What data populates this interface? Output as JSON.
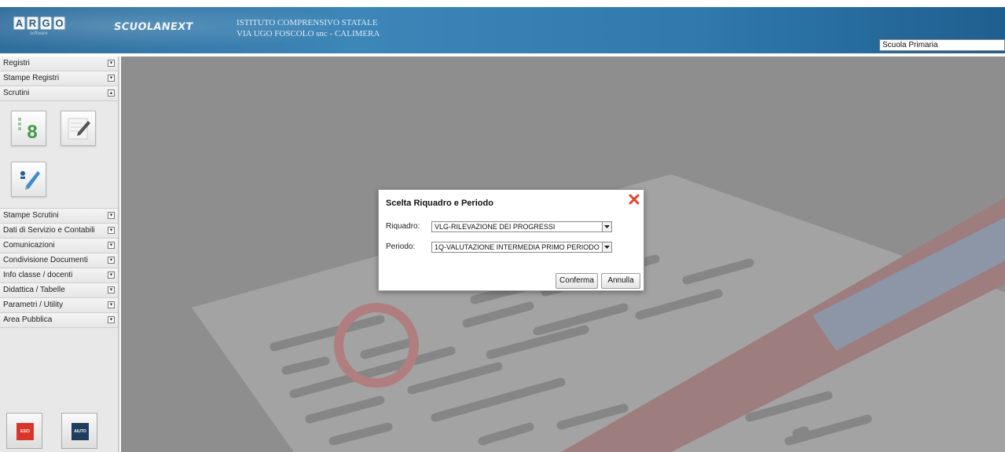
{
  "header": {
    "logo_letters": [
      "A",
      "R",
      "G",
      "O"
    ],
    "logo_sub": "software",
    "brand": "SCUOLANEXT",
    "school_line1": "ISTITUTO COMPRENSIVO STATALE",
    "school_line2": "VIA UGO FOSCOLO snc - CALIMERA",
    "school_type": "Scuola Primaria"
  },
  "sidebar": {
    "items_top": [
      {
        "label": "Registri",
        "toggle": "▾"
      },
      {
        "label": "Stampe Registri",
        "toggle": "▾"
      },
      {
        "label": "Scrutini",
        "toggle": "▴"
      }
    ],
    "items_bottom": [
      {
        "label": "Stampe Scrutini",
        "toggle": "▾"
      },
      {
        "label": "Dati di Servizio e Contabili",
        "toggle": "▾"
      },
      {
        "label": "Comunicazioni",
        "toggle": "▾"
      },
      {
        "label": "Condivisione Documenti",
        "toggle": "▾"
      },
      {
        "label": "Info classe / docenti",
        "toggle": "▾"
      },
      {
        "label": "Didattica / Tabelle",
        "toggle": "▾"
      },
      {
        "label": "Parametri / Utility",
        "toggle": "▾"
      },
      {
        "label": "Area Pubblica",
        "toggle": "▾"
      }
    ],
    "tools": {
      "voti_number": "8"
    },
    "exit_label": "ESCI",
    "help_label": "AIUTO"
  },
  "dialog": {
    "title": "Scelta Riquadro e Periodo",
    "riquadro_label": "Riquadro:",
    "riquadro_value": "VLG-RILEVAZIONE DEI PROGRESSI",
    "periodo_label": "Periodo:",
    "periodo_value": "1Q-VALUTAZIONE INTERMEDIA PRIMO PERIODO",
    "confirm_label": "Conferma",
    "cancel_label": "Annulla"
  },
  "colors": {
    "header_blue": "#3d86b8",
    "close_red": "#e8442b",
    "exit_red": "#d9362b",
    "help_navy": "#1f3d5c"
  }
}
